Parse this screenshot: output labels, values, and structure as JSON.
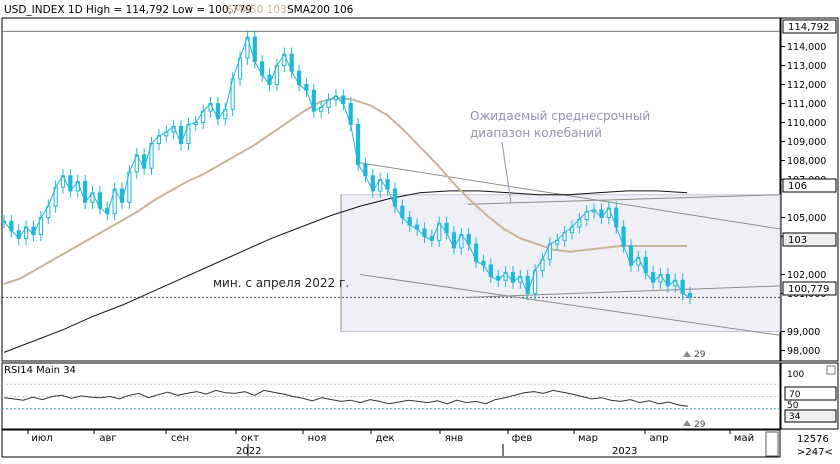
{
  "header": {
    "symbol": "USD_INDEX 1D High = 114,792 Low = 100,779",
    "sma50_label": "SMA50 103",
    "sma200_label": "SMA200 106"
  },
  "annotations": {
    "range_line1": "Ожидаемый среднесрочный",
    "range_line2": "диапазон колебаний",
    "min_label": "мин. с апреля 2022 г."
  },
  "price_badges": {
    "high": "114,792",
    "sma200": "106",
    "sma50": "103",
    "last": "100,779"
  },
  "price_ticks": [
    "114,000",
    "113,000",
    "112,000",
    "111,000",
    "110,000",
    "109,000",
    "108,000",
    "107,000",
    "105,000",
    "104,000",
    "102,000",
    "101,000",
    "99,000",
    "98,000"
  ],
  "volume_marker": "29",
  "rsi": {
    "label": "RSI14 Main 34",
    "ticks": [
      "100",
      "50"
    ],
    "badge70": "70",
    "badge34": "34",
    "marker": "29"
  },
  "time_axis": {
    "months": [
      "июл",
      "авг",
      "сен",
      "окт",
      "ноя",
      "дек",
      "янв",
      "фев",
      "мар",
      "апр",
      "май"
    ],
    "years": [
      "2022",
      "2023"
    ]
  },
  "status": {
    "count": "12576",
    "nav": ">247<"
  },
  "colors": {
    "candle": "#1fb8d8",
    "sma50": "#c8b49c",
    "sma200": "#000000",
    "channel": "#808080",
    "range_fill": "#f1eff6",
    "annotation": "#9a8fb4",
    "frame": "#000000"
  },
  "chart_data": [
    {
      "type": "line",
      "title": "USD_INDEX 1D",
      "period": "1D",
      "x_labels": [
        "июл",
        "авг",
        "сен",
        "окт",
        "ноя",
        "дек",
        "янв",
        "фев",
        "мар",
        "апр",
        "май"
      ],
      "ylim": [
        97.5,
        115.4
      ],
      "series": [
        {
          "name": "USD_INDEX",
          "values": [
            104.8,
            104.3,
            103.9,
            104.5,
            104.1,
            105.0,
            105.6,
            106.6,
            107.2,
            106.4,
            106.9,
            105.8,
            106.3,
            105.5,
            105.2,
            106.5,
            105.8,
            107.4,
            108.3,
            107.6,
            108.9,
            109.3,
            109.5,
            109.8,
            108.9,
            109.9,
            110.0,
            110.6,
            111.0,
            110.2,
            110.7,
            112.3,
            113.4,
            114.5,
            113.2,
            112.5,
            112.0,
            113.0,
            113.6,
            112.7,
            112.0,
            111.7,
            110.6,
            110.8,
            111.2,
            111.4,
            111.0,
            109.9,
            107.8,
            107.2,
            106.4,
            107.0,
            106.5,
            105.6,
            105.0,
            104.6,
            104.4,
            104.0,
            103.8,
            104.7,
            104.2,
            103.4,
            104.1,
            103.6,
            102.7,
            102.5,
            101.9,
            101.7,
            102.1,
            101.6,
            101.9,
            101.0,
            102.2,
            102.8,
            103.6,
            103.8,
            104.2,
            104.5,
            104.9,
            105.3,
            105.4,
            105.0,
            105.5,
            104.5,
            103.5,
            102.5,
            102.9,
            102.1,
            101.6,
            102.0,
            101.4,
            101.7,
            101.0,
            100.8
          ]
        },
        {
          "name": "SMA50",
          "values": [
            101.5,
            101.8,
            102.3,
            102.8,
            103.3,
            103.8,
            104.3,
            104.8,
            105.3,
            105.9,
            106.4,
            106.9,
            107.3,
            107.8,
            108.3,
            108.8,
            109.4,
            110.0,
            110.6,
            111.1,
            111.3,
            111.2,
            110.9,
            110.4,
            109.6,
            108.7,
            107.8,
            106.8,
            105.9,
            105.1,
            104.4,
            103.9,
            103.6,
            103.3,
            103.2,
            103.3,
            103.4,
            103.5,
            103.5,
            103.5,
            103.5,
            103.5
          ]
        },
        {
          "name": "SMA200",
          "values": [
            97.9,
            98.5,
            99.1,
            99.8,
            100.4,
            101.1,
            101.8,
            102.5,
            103.2,
            103.9,
            104.5,
            105.1,
            105.6,
            106.0,
            106.3,
            106.4,
            106.4,
            106.3,
            106.2,
            106.2,
            106.3,
            106.4,
            106.4,
            106.3
          ]
        }
      ],
      "channel": {
        "upper": [
          107.9,
          104.4
        ],
        "lower": [
          102.0,
          98.8
        ],
        "expected_range": [
          99.0,
          106.2
        ],
        "support": 100.8
      },
      "ylabel": ""
    },
    {
      "type": "line",
      "title": "RSI14 Main 34",
      "ylim": [
        0,
        100
      ],
      "levels": [
        70,
        50,
        30
      ],
      "series": [
        {
          "name": "RSI14",
          "values": [
            48,
            46,
            44,
            49,
            45,
            50,
            52,
            47,
            51,
            49,
            48,
            50,
            46,
            52,
            55,
            48,
            53,
            57,
            52,
            55,
            58,
            54,
            60,
            56,
            55,
            58,
            52,
            60,
            57,
            54,
            50,
            47,
            43,
            48,
            45,
            42,
            44,
            40,
            45,
            42,
            38,
            41,
            44,
            42,
            40,
            43,
            38,
            44,
            40,
            42,
            38,
            45,
            48,
            52,
            56,
            58,
            55,
            60,
            57,
            54,
            50,
            46,
            48,
            44,
            42,
            45,
            40,
            43,
            38,
            41,
            36,
            34
          ]
        }
      ],
      "ylabel": ""
    }
  ]
}
